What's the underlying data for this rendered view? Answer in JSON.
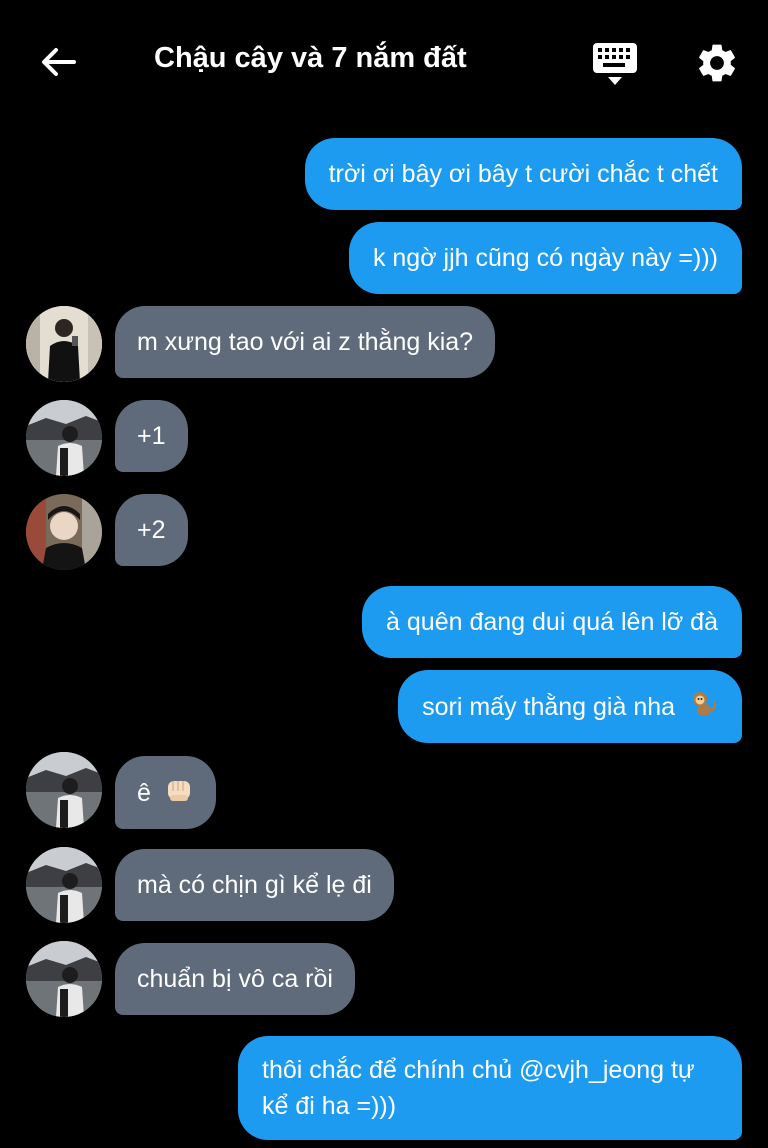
{
  "header": {
    "title": "Chậu cây và 7 nắm đất"
  },
  "messages": [
    {
      "side": "out",
      "text": "trời ơi bây ơi bây t cười chắc t chết"
    },
    {
      "side": "out",
      "text": "k ngờ jjh cũng có ngày này =)))"
    },
    {
      "side": "in",
      "text": "m xưng tao với ai z thằng kia?"
    },
    {
      "side": "in",
      "text": "+1"
    },
    {
      "side": "in",
      "text": "+2"
    },
    {
      "side": "out",
      "text": "à quên đang dui quá lên lỡ đà"
    },
    {
      "side": "out",
      "text": "sori mấy thằng già nha",
      "emoji": "monkey-emoji"
    },
    {
      "side": "in",
      "text": "ê",
      "emoji": "fist-bump-emoji"
    },
    {
      "side": "in",
      "text": "mà có chịn gì kể lẹ đi"
    },
    {
      "side": "in",
      "text": "chuẩn bị vô ca rồi"
    },
    {
      "side": "out",
      "text": "thôi chắc để chính chủ @cvjh_jeong tự kể đi ha =)))"
    }
  ],
  "colors": {
    "background": "#000000",
    "outgoing_bubble": "#1d9bf0",
    "incoming_bubble": "#5f6b7a"
  }
}
